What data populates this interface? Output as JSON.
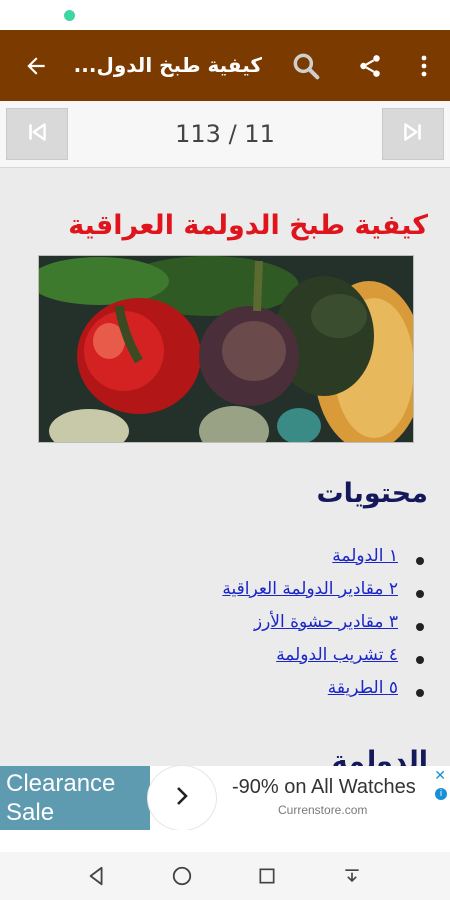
{
  "app_bar": {
    "title": "كيفية طبخ الدول...",
    "icons": [
      "arrow-back-icon",
      "search-icon",
      "share-icon",
      "more-vert-icon"
    ]
  },
  "pager": {
    "page_indicator": "113 / 11",
    "icons": [
      "first-page-icon",
      "last-page-icon"
    ]
  },
  "article": {
    "title": "كيفية طبخ الدولمة العراقية",
    "toc_heading": "محتويات",
    "toc": [
      "١ الدولمة",
      "٢ مقادير الدولمة العراقية",
      "٣ مقادير حشوة الأرز",
      "٤ تشريب الدولمة",
      "٥ الطريقة"
    ],
    "next_heading": "الدولمة"
  },
  "ad": {
    "headline": "Clearance Sale",
    "offer": "-90% on All Watches",
    "domain": "Currenstore.com",
    "close": "✕",
    "choices": "i"
  },
  "colors": {
    "app_bar": "#7b3a00",
    "title_red": "#e0141c",
    "heading_navy": "#14195c",
    "link_blue": "#1a26c9"
  }
}
